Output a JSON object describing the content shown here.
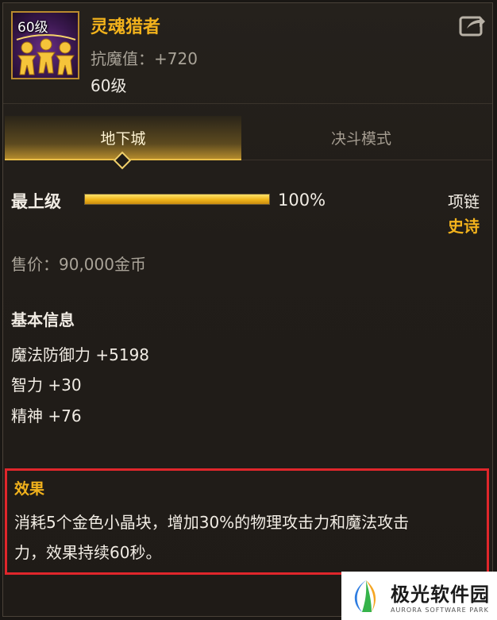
{
  "item": {
    "icon_level": "60级",
    "name": "灵魂猎者",
    "stat": "抗魔值：+720",
    "level": "60级"
  },
  "tabs": [
    {
      "label": "地下城",
      "active": true
    },
    {
      "label": "决斗模式",
      "active": false
    }
  ],
  "grade": {
    "label": "最上级",
    "percent_text": "100%",
    "fill_fraction": 1.0
  },
  "slot_type": "项链",
  "rarity": "史诗",
  "price": "售价：90,000金币",
  "basic_info": {
    "title": "基本信息",
    "attributes": [
      "魔法防御力 +5198",
      "智力 +30",
      "精神 +76"
    ]
  },
  "effect": {
    "title": "效果",
    "line1": "消耗5个金色小晶块，增加30%的物理攻击力和魔法攻击",
    "line2": "力，效果持续60秒。"
  },
  "watermark": {
    "cn": "极光软件园",
    "en": "AURORA SOFTWARE PARK"
  },
  "colors": {
    "gold": "#f2b21c",
    "highlight_border": "#e0262b",
    "panel_bg": "#221e1a"
  },
  "icons": {
    "item": "soul-dolls-icon",
    "share": "share-arrow-icon",
    "logo": "aurora-logo-icon"
  }
}
